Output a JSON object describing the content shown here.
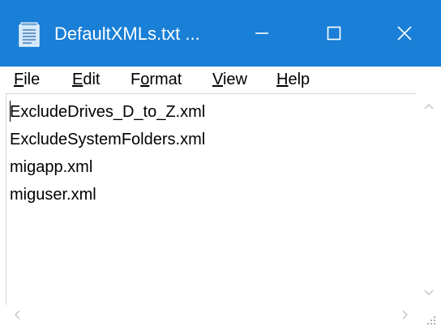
{
  "window": {
    "title": "DefaultXMLs.txt ...",
    "accent_color": "#1a7fd6",
    "buttons": {
      "minimize_icon": "minimize-icon",
      "maximize_icon": "maximize-icon",
      "close_icon": "close-icon"
    }
  },
  "menu": {
    "file": {
      "accel": "F",
      "rest": "ile"
    },
    "edit": {
      "accel": "E",
      "rest": "dit"
    },
    "format": {
      "pre": "F",
      "accel": "o",
      "rest": "rmat"
    },
    "view": {
      "accel": "V",
      "rest": "iew"
    },
    "help": {
      "accel": "H",
      "rest": "elp"
    }
  },
  "document": {
    "lines": [
      "ExcludeDrives_D_to_Z.xml",
      "ExcludeSystemFolders.xml",
      "migapp.xml",
      "miguser.xml"
    ]
  }
}
